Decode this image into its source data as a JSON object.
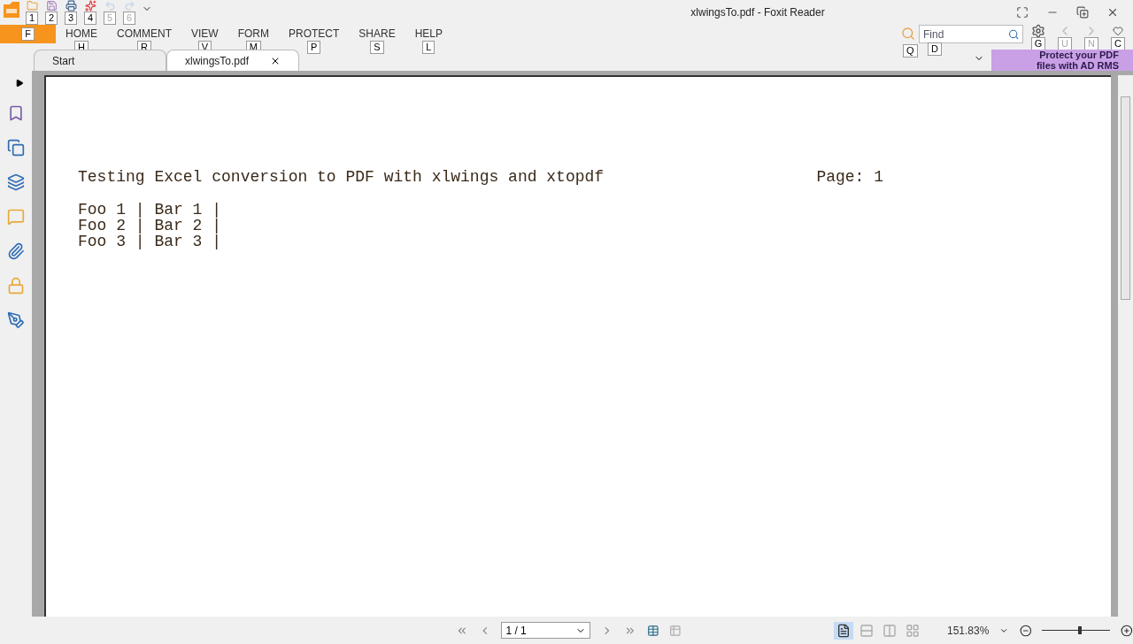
{
  "window": {
    "title": "xlwingsTo.pdf - Foxit Reader"
  },
  "quick_access": [
    {
      "keytip": "1",
      "disabled": false
    },
    {
      "keytip": "2",
      "disabled": false
    },
    {
      "keytip": "3",
      "disabled": false
    },
    {
      "keytip": "4",
      "disabled": false
    },
    {
      "keytip": "5",
      "disabled": true
    },
    {
      "keytip": "6",
      "disabled": true
    }
  ],
  "file_tab": {
    "keytip": "F"
  },
  "ribbon_tabs": [
    {
      "label": "HOME",
      "keytip": "H"
    },
    {
      "label": "COMMENT",
      "keytip": "R"
    },
    {
      "label": "VIEW",
      "keytip": "V"
    },
    {
      "label": "FORM",
      "keytip": "M"
    },
    {
      "label": "PROTECT",
      "keytip": "P"
    },
    {
      "label": "SHARE",
      "keytip": "S"
    },
    {
      "label": "HELP",
      "keytip": "L"
    }
  ],
  "find": {
    "placeholder": "Find",
    "folder_keytip": "Q",
    "field_keytip": "D"
  },
  "toolbar_buttons": [
    {
      "kind": "settings",
      "keytip": "G",
      "disabled": false
    },
    {
      "kind": "previous",
      "keytip": "U",
      "disabled": true
    },
    {
      "kind": "next",
      "keytip": "N",
      "disabled": true
    },
    {
      "kind": "like",
      "keytip": "C",
      "disabled": false
    }
  ],
  "ad": {
    "line_1": "Protect your PDF",
    "line_2": "files with AD RMS"
  },
  "doc_tabs": [
    {
      "label": "Start",
      "selected": false
    },
    {
      "label": "xlwingsTo.pdf",
      "selected": true
    }
  ],
  "document": {
    "header": "Testing Excel conversion to PDF with xlwings and xtopdf",
    "page_label": "Page: 1",
    "lines": [
      "Foo 1 | Bar 1 |",
      "Foo 2 | Bar 2 |",
      "Foo 3 | Bar 3 |"
    ]
  },
  "status_bar": {
    "page": "1 / 1",
    "view_modes": [
      {
        "selected": true
      },
      {
        "selected": false
      },
      {
        "selected": false
      },
      {
        "selected": false
      }
    ],
    "zoom": "151.83%",
    "zoom_slider": {
      "level": 0.55
    }
  }
}
